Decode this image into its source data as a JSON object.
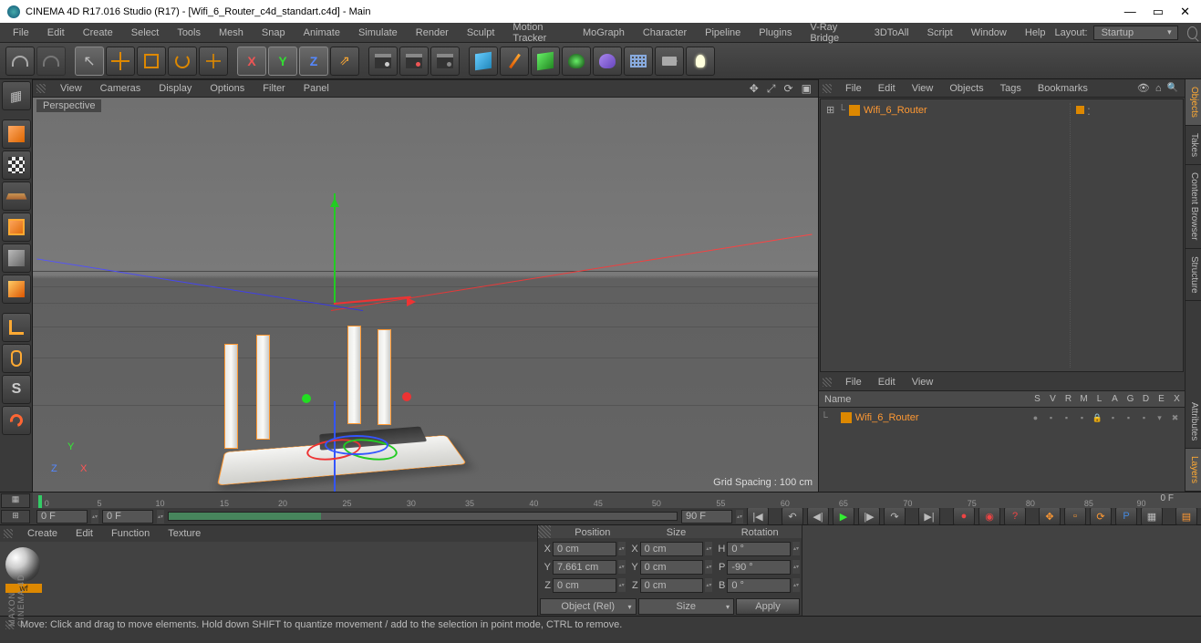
{
  "title": "CINEMA 4D R17.016 Studio (R17) - [Wifi_6_Router_c4d_standart.c4d] - Main",
  "menu": [
    "File",
    "Edit",
    "Create",
    "Select",
    "Tools",
    "Mesh",
    "Snap",
    "Animate",
    "Simulate",
    "Render",
    "Sculpt",
    "Motion Tracker",
    "MoGraph",
    "Character",
    "Pipeline",
    "Plugins",
    "V-Ray Bridge",
    "3DToAll",
    "Script",
    "Window",
    "Help"
  ],
  "layout_label": "Layout:",
  "layout_value": "Startup",
  "viewport": {
    "menu": [
      "View",
      "Cameras",
      "Display",
      "Options",
      "Filter",
      "Panel"
    ],
    "label": "Perspective",
    "grid_spacing": "Grid Spacing : 100 cm",
    "mini": {
      "y": "Y",
      "x": "X",
      "z": "Z"
    }
  },
  "objects_panel": {
    "menu": [
      "File",
      "Edit",
      "View",
      "Objects",
      "Tags",
      "Bookmarks"
    ],
    "item": "Wifi_6_Router"
  },
  "layers_panel": {
    "menu": [
      "File",
      "Edit",
      "View"
    ],
    "header": "Name",
    "cols": [
      "S",
      "V",
      "R",
      "M",
      "L",
      "A",
      "G",
      "D",
      "E",
      "X"
    ],
    "item": "Wifi_6_Router"
  },
  "side_tabs": [
    "Objects",
    "Takes",
    "Content Browser",
    "Structure",
    "Attributes",
    "Layers"
  ],
  "timeline": {
    "start": "0 F",
    "pos": "0 F",
    "end": "90 F",
    "end_label": "0 F",
    "ticks": [
      "0",
      "5",
      "10",
      "15",
      "20",
      "25",
      "30",
      "35",
      "40",
      "45",
      "50",
      "55",
      "60",
      "65",
      "70",
      "75",
      "80",
      "85",
      "90"
    ]
  },
  "materials": {
    "menu": [
      "Create",
      "Edit",
      "Function",
      "Texture"
    ],
    "item": "wf"
  },
  "coords": {
    "headers": [
      "Position",
      "Size",
      "Rotation"
    ],
    "rows": [
      {
        "a": "X",
        "p": "0 cm",
        "sa": "X",
        "s": "0 cm",
        "ra": "H",
        "r": "0 °"
      },
      {
        "a": "Y",
        "p": "7.661 cm",
        "sa": "Y",
        "s": "0 cm",
        "ra": "P",
        "r": "-90 °"
      },
      {
        "a": "Z",
        "p": "0 cm",
        "sa": "Z",
        "s": "0 cm",
        "ra": "B",
        "r": "0 °"
      }
    ],
    "mode": "Object (Rel)",
    "size_mode": "Size",
    "apply": "Apply"
  },
  "status": "Move: Click and drag to move elements. Hold down SHIFT to quantize movement / add to the selection in point mode, CTRL to remove.",
  "badge": "MAXON CINEMA 4D"
}
